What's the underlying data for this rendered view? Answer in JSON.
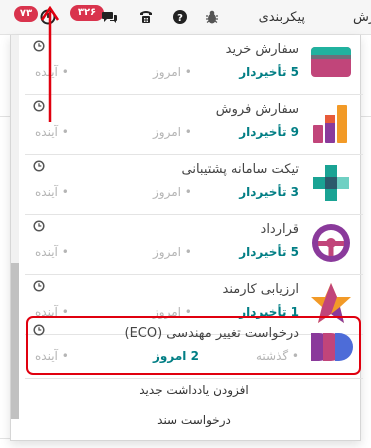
{
  "navbar": {
    "activities_badge": "۷۳",
    "messages_badge": "۳۲۶",
    "menu_configuration": "پیکربندی",
    "menu_reporting_partial": "رش"
  },
  "activities": [
    {
      "title": "سفارش خرید",
      "late": "5 تأخیردار",
      "today": "• امروز",
      "future": "• آینده",
      "icon": "purchase-icon"
    },
    {
      "title": "سفارش فروش",
      "late": "9 تأخیردار",
      "today": "• امروز",
      "future": "• آینده",
      "icon": "sales-icon"
    },
    {
      "title": "تیکت سامانه پشتیبانی",
      "late": "3 تأخیردار",
      "today": "• امروز",
      "future": "• آینده",
      "icon": "helpdesk-icon"
    },
    {
      "title": "قرارداد",
      "late": "5 تأخیردار",
      "today": "• امروز",
      "future": "• آینده",
      "icon": "fleet-steering-wheel-icon"
    },
    {
      "title": "ارزیابی کارمند",
      "late": "1 تأخیردار",
      "today": "• امروز",
      "future": "• آینده",
      "icon": "appraisal-star-icon"
    },
    {
      "title": "درخواست تغییر مهندسی (ECO)",
      "overdue": "• گذشته",
      "today_count": "2 امروز",
      "future": "• آینده",
      "icon": "plm-icon"
    }
  ],
  "footer": {
    "add_note": "افزودن یادداشت جدید",
    "request_document": "درخواست سند"
  },
  "colors": {
    "accent": "#017e84",
    "badge": "#d9334d",
    "annotation": "#e0000f"
  }
}
